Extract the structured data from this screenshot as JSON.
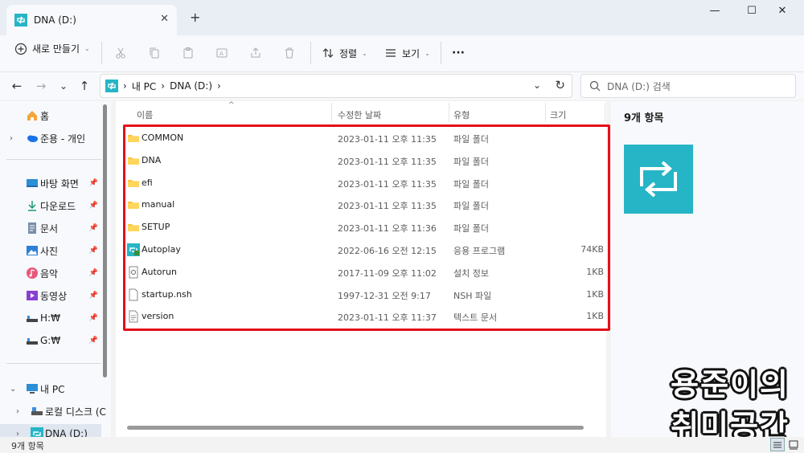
{
  "window": {
    "tab_title": "DNA (D:)",
    "new_tab": "+",
    "minimize": "—",
    "maximize": "☐",
    "close": "✕"
  },
  "toolbar": {
    "new_label": "새로 만들기",
    "sort_label": "정렬",
    "view_label": "보기",
    "more_label": "···"
  },
  "address": {
    "crumbs": [
      "내 PC",
      "DNA (D:)"
    ],
    "search_placeholder": "DNA (D:) 검색"
  },
  "sidebar": {
    "items": [
      {
        "label": "홈",
        "icon": "home-icon"
      },
      {
        "label": "준용 - 개인",
        "icon": "onedrive-icon"
      },
      {
        "label": "바탕 화면",
        "icon": "desktop-icon"
      },
      {
        "label": "다운로드",
        "icon": "download-icon"
      },
      {
        "label": "문서",
        "icon": "document-icon"
      },
      {
        "label": "사진",
        "icon": "pictures-icon"
      },
      {
        "label": "음악",
        "icon": "music-icon"
      },
      {
        "label": "동영상",
        "icon": "video-icon"
      },
      {
        "label": "H:₩",
        "icon": "drive-icon"
      },
      {
        "label": "G:₩",
        "icon": "drive-icon"
      },
      {
        "label": "내 PC",
        "icon": "pc-icon"
      },
      {
        "label": "로컬 디스크 (C",
        "icon": "disk-icon"
      },
      {
        "label": "DNA (D:)",
        "icon": "dna-drive-icon"
      }
    ]
  },
  "columns": {
    "name": "이름",
    "date": "수정한 날짜",
    "type": "유형",
    "size": "크기"
  },
  "files": [
    {
      "name": "COMMON",
      "date": "2023-01-11 오후 11:35",
      "type": "파일 폴더",
      "size": "",
      "icon": "folder-icon"
    },
    {
      "name": "DNA",
      "date": "2023-01-11 오후 11:35",
      "type": "파일 폴더",
      "size": "",
      "icon": "folder-icon"
    },
    {
      "name": "efi",
      "date": "2023-01-11 오후 11:35",
      "type": "파일 폴더",
      "size": "",
      "icon": "folder-icon"
    },
    {
      "name": "manual",
      "date": "2023-01-11 오후 11:35",
      "type": "파일 폴더",
      "size": "",
      "icon": "folder-icon"
    },
    {
      "name": "SETUP",
      "date": "2023-01-11 오후 11:36",
      "type": "파일 폴더",
      "size": "",
      "icon": "folder-icon"
    },
    {
      "name": "Autoplay",
      "date": "2022-06-16 오전 12:15",
      "type": "응용 프로그램",
      "size": "74KB",
      "icon": "app-icon"
    },
    {
      "name": "Autorun",
      "date": "2017-11-09 오후 11:02",
      "type": "설치 정보",
      "size": "1KB",
      "icon": "setup-info-icon"
    },
    {
      "name": "startup.nsh",
      "date": "1997-12-31 오전 9:17",
      "type": "NSH 파일",
      "size": "1KB",
      "icon": "file-icon"
    },
    {
      "name": "version",
      "date": "2023-01-11 오후 11:37",
      "type": "텍스트 문서",
      "size": "1KB",
      "icon": "text-file-icon"
    }
  ],
  "preview": {
    "count": "9개 항목"
  },
  "status": {
    "count": "9개 항목"
  },
  "watermark": {
    "line1": "용준이의",
    "line2": "취미공간"
  },
  "colors": {
    "accent": "#26b5c6",
    "highlight": "#e3101a",
    "folder": "#f7c544"
  }
}
